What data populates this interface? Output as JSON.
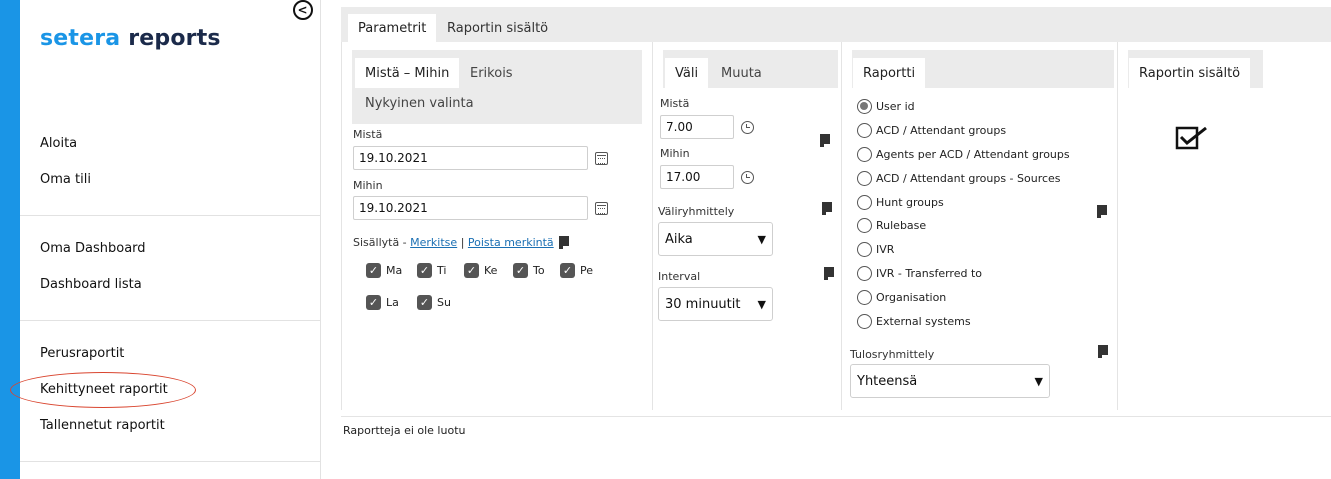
{
  "brand": {
    "part1": "setera",
    "part2": "reports",
    "accent": "#1a95e6",
    "dark": "#1b2a4a"
  },
  "sidebar": {
    "collapse_icon": "chevron-left-circle-icon",
    "group1": [
      "Aloita",
      "Oma tili"
    ],
    "group2": [
      "Oma Dashboard",
      "Dashboard lista"
    ],
    "group3": [
      "Perusraportit",
      "Kehittyneet raportit",
      "Tallennetut raportit"
    ]
  },
  "top_tabs": [
    "Parametrit",
    "Raportin sisältö"
  ],
  "date_panel": {
    "tabs": [
      "Mistä – Mihin",
      "Erikois",
      "Nykyinen valinta"
    ],
    "from_label": "Mistä",
    "from_value": "19.10.2021",
    "to_label": "Mihin",
    "to_value": "19.10.2021",
    "include_label": "Sisällytä -",
    "mark_all": "Merkitse",
    "separator": "|",
    "unmark_all": "Poista merkintä",
    "days": [
      "Ma",
      "Ti",
      "Ke",
      "To",
      "Pe",
      "La",
      "Su"
    ]
  },
  "time_panel": {
    "tabs": [
      "Väli",
      "Muuta"
    ],
    "from_label": "Mistä",
    "from_value": "7.00",
    "to_label": "Mihin",
    "to_value": "17.00",
    "grouping_label": "Väliryhmittely",
    "grouping_value": "Aika",
    "interval_label": "Interval",
    "interval_value": "30 minuutit"
  },
  "report_panel": {
    "tab": "Raportti",
    "options": [
      "User id",
      "ACD / Attendant groups",
      "Agents per ACD / Attendant groups",
      "ACD / Attendant groups - Sources",
      "Hunt groups",
      "Rulebase",
      "IVR",
      "IVR - Transferred to",
      "Organisation",
      "External systems"
    ],
    "selected": "User id",
    "result_group_label": "Tulosryhmittely",
    "result_group_value": "Yhteensä"
  },
  "content_panel": {
    "tab": "Raportin sisältö",
    "icon": "checkbox-checked-icon"
  },
  "status": "Raportteja ei ole luotu"
}
